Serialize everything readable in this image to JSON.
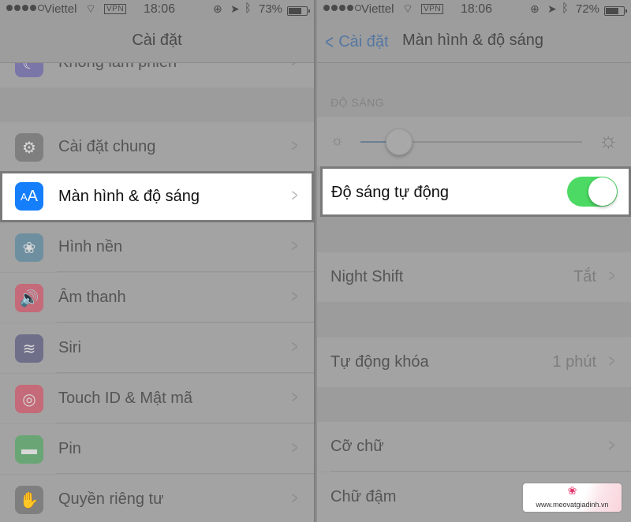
{
  "left": {
    "status": {
      "carrier": "Viettel",
      "vpn": "VPN",
      "time": "18:06",
      "battery": "73%",
      "battery_level": 0.73
    },
    "nav": {
      "title": "Cài đặt"
    },
    "items": [
      {
        "label": "Không làm phiền",
        "icon": "moon-icon",
        "color": "#7b76a8"
      },
      {
        "label": "Cài đặt chung",
        "icon": "gear-icon",
        "color": "#7f7f7f"
      },
      {
        "label": "Màn hình & độ sáng",
        "icon": "display-brightness-icon",
        "color": "#157efb",
        "glyph": "AA",
        "highlighted": true
      },
      {
        "label": "Hình nền",
        "icon": "wallpaper-flower-icon",
        "color": "#6e8fa0"
      },
      {
        "label": "Âm thanh",
        "icon": "speaker-icon",
        "color": "#c46a78"
      },
      {
        "label": "Siri",
        "icon": "siri-icon",
        "color": "#6f6f8a"
      },
      {
        "label": "Touch ID & Mật mã",
        "icon": "fingerprint-icon",
        "color": "#c46a78"
      },
      {
        "label": "Pin",
        "icon": "battery-icon",
        "color": "#6aa675"
      },
      {
        "label": "Quyền riêng tư",
        "icon": "hand-icon",
        "color": "#7f7f7f"
      }
    ]
  },
  "right": {
    "status": {
      "carrier": "Viettel",
      "vpn": "VPN",
      "time": "18:06",
      "battery": "72%",
      "battery_level": 0.72
    },
    "nav": {
      "back_label": "Cài đặt",
      "title": "Màn hình & độ sáng"
    },
    "brightness": {
      "section_header": "ĐỘ SÁNG",
      "level": 0.12
    },
    "auto_brightness": {
      "label": "Độ sáng tự động",
      "on": true
    },
    "night_shift": {
      "label": "Night Shift",
      "value": "Tắt"
    },
    "auto_lock": {
      "label": "Tự động khóa",
      "value": "1 phút"
    },
    "text_size": {
      "label": "Cỡ chữ"
    },
    "bold_text": {
      "label": "Chữ đậm"
    }
  },
  "watermark": {
    "url": "www.meovatgiadinh.vn"
  }
}
